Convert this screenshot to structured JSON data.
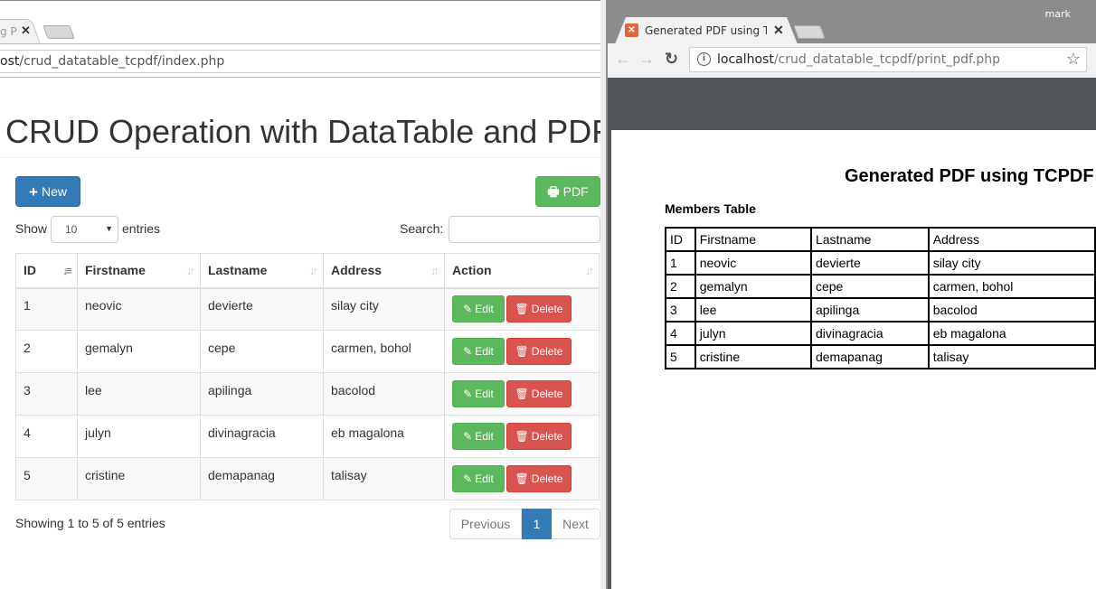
{
  "left_window": {
    "tab_title": "g P",
    "url_host": "ost",
    "url_path": "/crud_datatable_tcpdf/index.php",
    "page_title": "CRUD Operation with DataTable and PDF",
    "new_button": "New",
    "pdf_button": "PDF",
    "show_label": "Show",
    "entries_label": "entries",
    "page_length": "10",
    "search_label": "Search:",
    "search_value": "",
    "columns": [
      "ID",
      "Firstname",
      "Lastname",
      "Address",
      "Action"
    ],
    "sorted_column": "ID",
    "rows": [
      {
        "id": "1",
        "firstname": "neovic",
        "lastname": "devierte",
        "address": "silay city"
      },
      {
        "id": "2",
        "firstname": "gemalyn",
        "lastname": "cepe",
        "address": "carmen, bohol"
      },
      {
        "id": "3",
        "firstname": "lee",
        "lastname": "apilinga",
        "address": "bacolod"
      },
      {
        "id": "4",
        "firstname": "julyn",
        "lastname": "divinagracia",
        "address": "eb magalona"
      },
      {
        "id": "5",
        "firstname": "cristine",
        "lastname": "demapanag",
        "address": "talisay"
      }
    ],
    "edit_label": "Edit",
    "delete_label": "Delete",
    "info_text": "Showing 1 to 5 of 5 entries",
    "pagination": {
      "previous": "Previous",
      "current": "1",
      "next": "Next"
    }
  },
  "right_window": {
    "user": "mark",
    "tab_title": "Generated PDF using TCPDF",
    "url_host": "localhost",
    "url_path": "/crud_datatable_tcpdf/print_pdf.php",
    "pdf": {
      "title": "Generated PDF using TCPDF",
      "subtitle": "Members Table",
      "columns": [
        "ID",
        "Firstname",
        "Lastname",
        "Address"
      ],
      "rows": [
        [
          "1",
          "neovic",
          "devierte",
          "silay city"
        ],
        [
          "2",
          "gemalyn",
          "cepe",
          "carmen, bohol"
        ],
        [
          "3",
          "lee",
          "apilinga",
          "bacolod"
        ],
        [
          "4",
          "julyn",
          "divinagracia",
          "eb magalona"
        ],
        [
          "5",
          "cristine",
          "demapanag",
          "talisay"
        ]
      ]
    }
  },
  "colors": {
    "primary": "#337ab7",
    "success": "#5cb85c",
    "danger": "#d9534f",
    "pdf_viewer_bg": "#525659"
  }
}
